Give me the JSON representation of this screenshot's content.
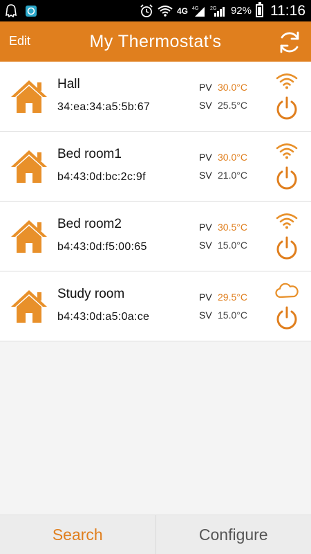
{
  "status_bar": {
    "network_1": "4G",
    "network_2": "4G",
    "network_3": "2G",
    "battery": "92%",
    "battery_level": 0.92,
    "time": "11:16"
  },
  "header": {
    "edit_label": "Edit",
    "title": "My Thermostat's",
    "refresh_icon": "refresh-icon"
  },
  "colors": {
    "accent": "#e07f1e",
    "header_bg": "#e07f1e",
    "status_bar_bg": "#000000",
    "list_bg": "#ffffff",
    "page_bg": "#f4f4f4"
  },
  "thermostats": [
    {
      "name": "Hall",
      "mac": "34:ea:34:a5:5b:67",
      "pv_label": "PV",
      "pv": "30.0°C",
      "sv_label": "SV",
      "sv": "25.5°C",
      "connection": "wifi-icon"
    },
    {
      "name": "Bed room1",
      "mac": "b4:43:0d:bc:2c:9f",
      "pv_label": "PV",
      "pv": "30.0°C",
      "sv_label": "SV",
      "sv": "21.0°C",
      "connection": "wifi-icon"
    },
    {
      "name": "Bed room2",
      "mac": "b4:43:0d:f5:00:65",
      "pv_label": "PV",
      "pv": "30.5°C",
      "sv_label": "SV",
      "sv": "15.0°C",
      "connection": "wifi-icon"
    },
    {
      "name": "Study room",
      "mac": "b4:43:0d:a5:0a:ce",
      "pv_label": "PV",
      "pv": "29.5°C",
      "sv_label": "SV",
      "sv": "15.0°C",
      "connection": "cloud-icon"
    }
  ],
  "bottom_tabs": {
    "search": "Search",
    "configure": "Configure"
  }
}
